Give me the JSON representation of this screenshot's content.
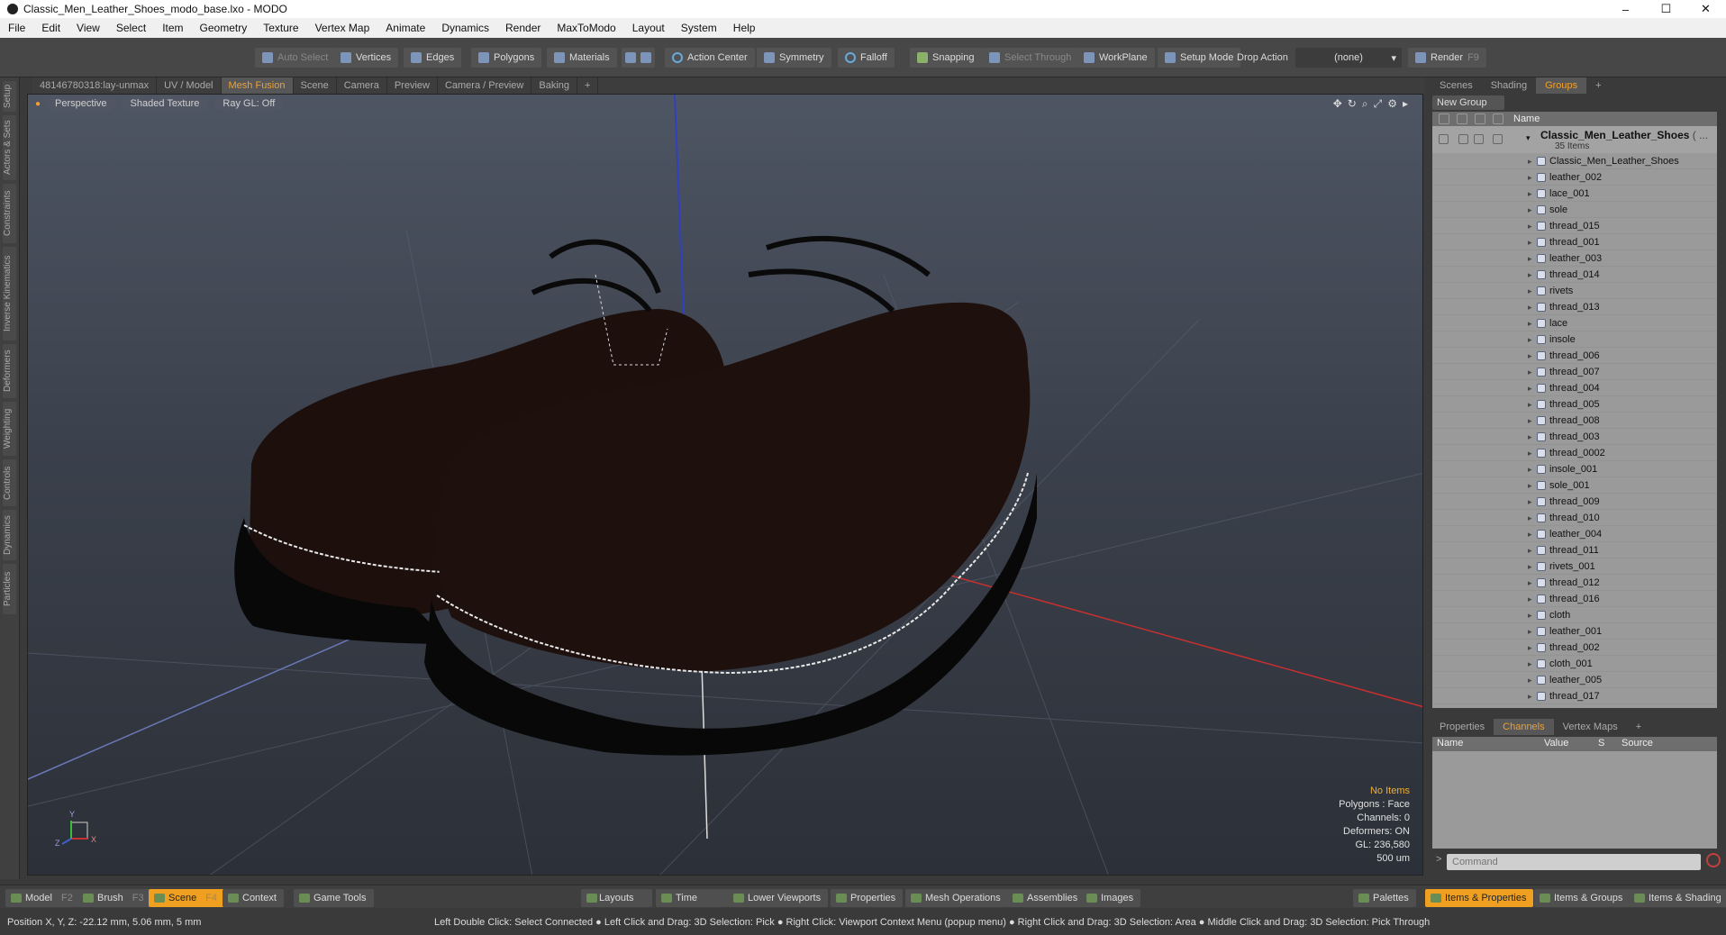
{
  "window": {
    "title": "Classic_Men_Leather_Shoes_modo_base.lxo - MODO",
    "minimize": "–",
    "maximize": "☐",
    "close": "✕"
  },
  "menu": [
    "File",
    "Edit",
    "View",
    "Select",
    "Item",
    "Geometry",
    "Texture",
    "Vertex Map",
    "Animate",
    "Dynamics",
    "Render",
    "MaxToModo",
    "Layout",
    "System",
    "Help"
  ],
  "toolbar": {
    "auto_select": "Auto Select",
    "vertices": "Vertices",
    "edges": "Edges",
    "polygons": "Polygons",
    "materials": "Materials",
    "action_center": "Action Center",
    "symmetry": "Symmetry",
    "falloff": "Falloff",
    "snapping": "Snapping",
    "select_through": "Select Through",
    "workplane": "WorkPlane",
    "setup_mode": "Setup Mode",
    "drop_action_label": "Drop Action",
    "drop_action_value": "(none)",
    "render": "Render",
    "render_key": "F9"
  },
  "viewport_tabs": [
    "48146780318:lay-unmax",
    "UV / Model",
    "Mesh Fusion",
    "Scene",
    "Camera",
    "Preview",
    "Camera / Preview",
    "Baking",
    "+"
  ],
  "active_viewport_tab": "Mesh Fusion",
  "left_tabs": [
    "Setup",
    "Actors & Sets",
    "Constraints",
    "Inverse Kinematics",
    "Deformers",
    "Weighting",
    "Controls",
    "Dynamics",
    "Particles"
  ],
  "viewport": {
    "projection": "Perspective",
    "shading": "Shaded Texture",
    "raygl": "Ray GL: Off",
    "hud": {
      "items": "No Items",
      "polygons": "Polygons : Face",
      "channels": "Channels: 0",
      "deformers": "Deformers: ON",
      "gl": "GL: 236,580",
      "scale": "500 um"
    },
    "axis": {
      "x": "X",
      "y": "Y",
      "z": "Z"
    }
  },
  "right_panel": {
    "tabs": [
      "Scenes",
      "Shading",
      "Groups",
      "+"
    ],
    "active_tab": "Groups",
    "new_group": "New Group",
    "name_header": "Name",
    "group_name": "Classic_Men_Leather_Shoes",
    "group_name_suffix": "( ...",
    "group_count": "35 Items",
    "items": [
      "Classic_Men_Leather_Shoes",
      "leather_002",
      "lace_001",
      "sole",
      "thread_015",
      "thread_001",
      "leather_003",
      "thread_014",
      "rivets",
      "thread_013",
      "lace",
      "insole",
      "thread_006",
      "thread_007",
      "thread_004",
      "thread_005",
      "thread_008",
      "thread_003",
      "thread_0002",
      "insole_001",
      "sole_001",
      "thread_009",
      "thread_010",
      "leather_004",
      "thread_011",
      "rivets_001",
      "thread_012",
      "thread_016",
      "cloth",
      "leather_001",
      "thread_002",
      "cloth_001",
      "leather_005",
      "thread_017"
    ]
  },
  "channels_panel": {
    "tabs": [
      "Properties",
      "Channels",
      "Vertex Maps",
      "+"
    ],
    "active_tab": "Channels",
    "headers": {
      "name": "Name",
      "value": "Value",
      "s": "S",
      "source": "Source"
    },
    "command_placeholder": "Command"
  },
  "bottom_tabs": {
    "model": "Model",
    "model_key": "F2",
    "brush": "Brush",
    "brush_key": "F3",
    "scene": "Scene",
    "scene_key": "F4",
    "context": "Context",
    "game_tools": "Game Tools",
    "layouts": "Layouts",
    "time": "Time",
    "lower_viewports": "Lower Viewports",
    "properties": "Properties",
    "mesh_operations": "Mesh Operations",
    "assemblies": "Assemblies",
    "images": "Images",
    "palettes": "Palettes",
    "items_properties": "Items & Properties",
    "items_groups": "Items & Groups",
    "items_shading": "Items & Shading"
  },
  "status": {
    "position": "Position X, Y, Z:   -22.12 mm, 5.06 mm, 5 mm",
    "hint": "Left Double Click: Select Connected ● Left Click and Drag: 3D Selection: Pick ● Right Click: Viewport Context Menu (popup menu) ● Right Click and Drag: 3D Selection: Area ● Middle Click and Drag: 3D Selection: Pick Through"
  },
  "colors": {
    "accent": "#f0a030",
    "axis_x": "#c83030",
    "axis_y": "#3040c0",
    "shoe": "#1c0f0c",
    "stitch": "#e8e8e8"
  }
}
